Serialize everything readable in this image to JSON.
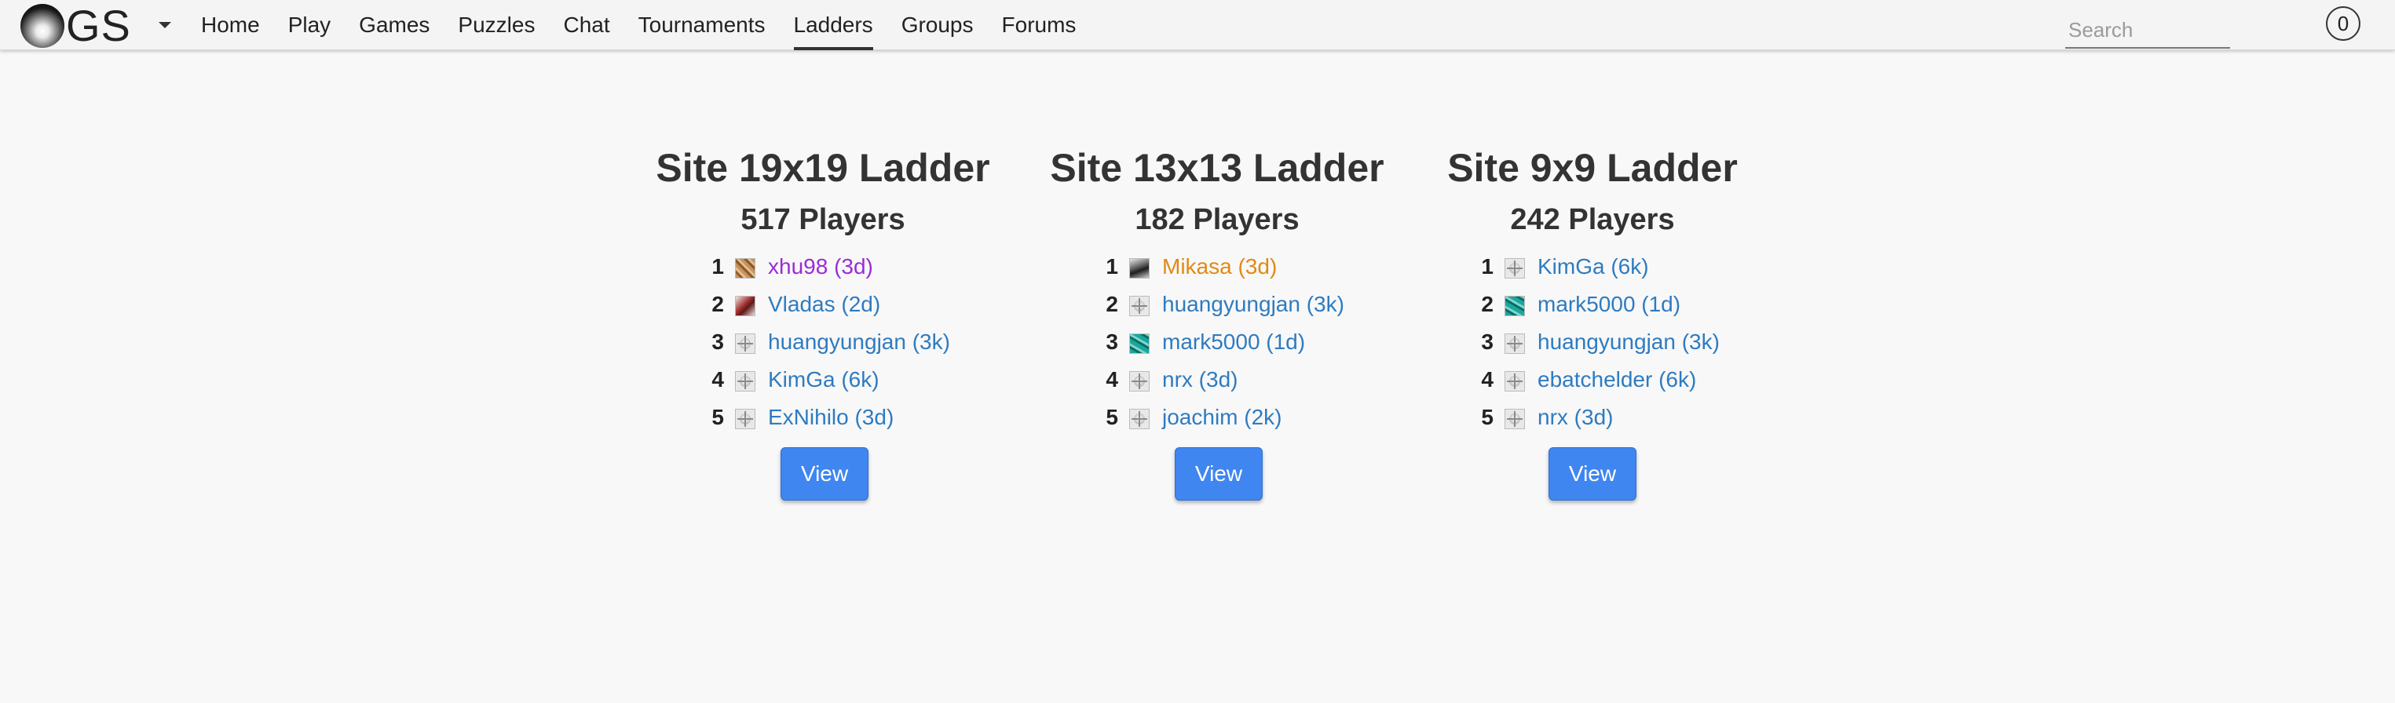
{
  "nav": {
    "logo_text": "GS",
    "links": [
      "Home",
      "Play",
      "Games",
      "Puzzles",
      "Chat",
      "Tournaments",
      "Ladders",
      "Groups",
      "Forums"
    ],
    "active": "Ladders",
    "search_placeholder": "Search",
    "notification_count": "0"
  },
  "colors": {
    "link": "#2e7bc1",
    "highlight_purple": "#9b2bd6",
    "highlight_orange": "#e08a13",
    "button": "#3f86f0"
  },
  "ladders": [
    {
      "title": "Site 19x19 Ladder",
      "players": "517 Players",
      "view_label": "View",
      "entries": [
        {
          "rank": "1",
          "name": "xhu98 (3d)",
          "avatar": "tan-avatar",
          "color": "purple"
        },
        {
          "rank": "2",
          "name": "Vladas (2d)",
          "avatar": "red-avatar",
          "color": "blue"
        },
        {
          "rank": "3",
          "name": "huangyungjan (3k)",
          "avatar": "default-avatar",
          "color": "blue"
        },
        {
          "rank": "4",
          "name": "KimGa (6k)",
          "avatar": "default-avatar",
          "color": "blue"
        },
        {
          "rank": "5",
          "name": "ExNihilo (3d)",
          "avatar": "default-avatar",
          "color": "blue"
        }
      ]
    },
    {
      "title": "Site 13x13 Ladder",
      "players": "182 Players",
      "view_label": "View",
      "entries": [
        {
          "rank": "1",
          "name": "Mikasa (3d)",
          "avatar": "bw-avatar",
          "color": "orange"
        },
        {
          "rank": "2",
          "name": "huangyungjan (3k)",
          "avatar": "default-avatar",
          "color": "blue"
        },
        {
          "rank": "3",
          "name": "mark5000 (1d)",
          "avatar": "teal-avatar",
          "color": "blue"
        },
        {
          "rank": "4",
          "name": "nrx (3d)",
          "avatar": "default-avatar",
          "color": "blue"
        },
        {
          "rank": "5",
          "name": "joachim (2k)",
          "avatar": "default-avatar",
          "color": "blue"
        }
      ]
    },
    {
      "title": "Site 9x9 Ladder",
      "players": "242 Players",
      "view_label": "View",
      "entries": [
        {
          "rank": "1",
          "name": "KimGa (6k)",
          "avatar": "default-avatar",
          "color": "blue"
        },
        {
          "rank": "2",
          "name": "mark5000 (1d)",
          "avatar": "teal-avatar",
          "color": "blue"
        },
        {
          "rank": "3",
          "name": "huangyungjan (3k)",
          "avatar": "default-avatar",
          "color": "blue"
        },
        {
          "rank": "4",
          "name": "ebatchelder (6k)",
          "avatar": "default-avatar",
          "color": "blue"
        },
        {
          "rank": "5",
          "name": "nrx (3d)",
          "avatar": "default-avatar",
          "color": "blue"
        }
      ]
    }
  ]
}
